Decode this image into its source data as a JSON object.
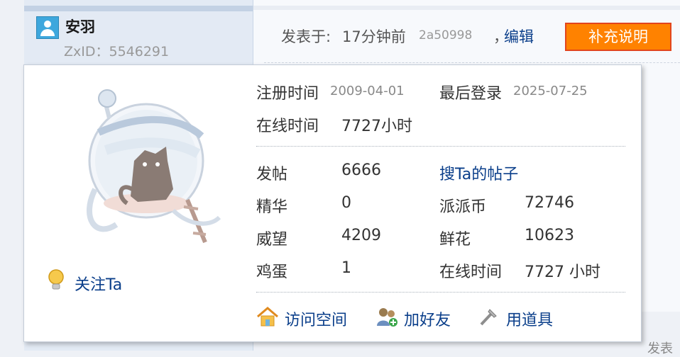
{
  "post": {
    "author_name": "安羽",
    "author_id": "ZxID：5546291",
    "time_label": "发表于:",
    "time_value": "17分钟前",
    "hash": "2a50998",
    "comma": "，",
    "edit_label": "编辑",
    "supplement_label": "补充说明",
    "bottom_fragment": "发表"
  },
  "card": {
    "reg_label": "注册时间",
    "reg_date": "2009-04-01",
    "last_login_label": "最后登录",
    "last_login_date": "2025-07-25",
    "online_label": "在线时间",
    "online_value": "7727小时",
    "follow_label": "关注Ta",
    "stats": {
      "posts_label": "发帖",
      "posts_value": "6666",
      "search_posts_label": "搜Ta的帖子",
      "digest_label": "精华",
      "digest_value": "0",
      "coins_label": "派派币",
      "coins_value": "72746",
      "prestige_label": "威望",
      "prestige_value": "4209",
      "flowers_label": "鲜花",
      "flowers_value": "10623",
      "eggs_label": "鸡蛋",
      "eggs_value": "1",
      "online2_label": "在线时间",
      "online2_value": "7727 小时"
    },
    "actions": {
      "visit_space": "访问空间",
      "add_friend": "加好友",
      "use_item": "用道具"
    }
  },
  "colors": {
    "accent_link": "#0a3e8a",
    "button_orange": "#ff8200",
    "button_border": "#e2451d"
  }
}
